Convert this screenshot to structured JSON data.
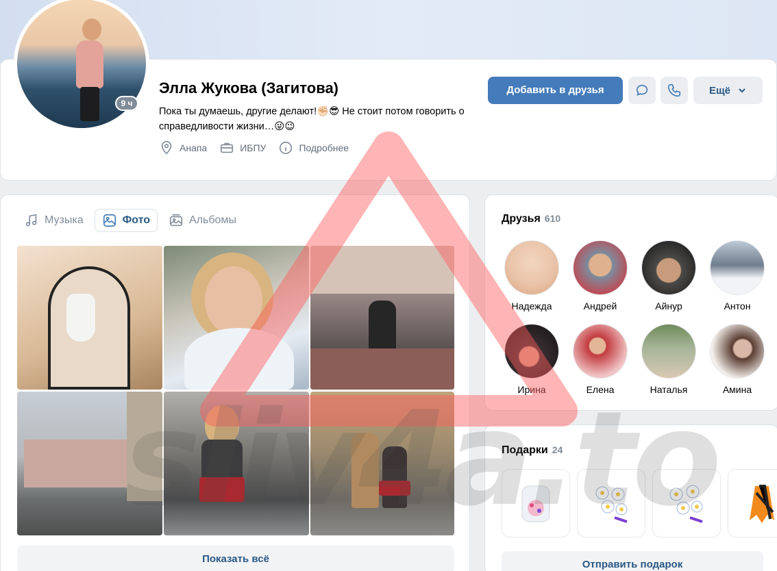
{
  "profile": {
    "name": "Элла Жукова (Загитова)",
    "status": "Пока ты думаешь, другие делают!✊🏻😎 Не стоит потом говорить о справедливости жизни…😜😉",
    "time_ago": "9 ч",
    "meta": {
      "city": "Анапа",
      "work": "ИБПУ",
      "details": "Подробнее"
    }
  },
  "actions": {
    "add_friend": "Добавить в друзья",
    "more": "Ещё"
  },
  "tabs": [
    {
      "label": "Музыка",
      "icon": "music-note-icon"
    },
    {
      "label": "Фото",
      "icon": "photo-icon"
    },
    {
      "label": "Альбомы",
      "icon": "albums-icon"
    }
  ],
  "photos": {
    "show_all": "Показать всё"
  },
  "friends": {
    "title": "Друзья",
    "count": "610",
    "list": [
      {
        "name": "Надежда",
        "color": "#e9c3a8"
      },
      {
        "name": "Андрей",
        "color": "#7b8d9e"
      },
      {
        "name": "Айнур",
        "color": "#8a7a6a"
      },
      {
        "name": "Антон",
        "color": "#c9d3de"
      },
      {
        "name": "Ирина",
        "color": "#3b3033"
      },
      {
        "name": "Елена",
        "color": "#d7464a"
      },
      {
        "name": "Наталья",
        "color": "#6f8b5a"
      },
      {
        "name": "Амина",
        "color": "#d9b8a7"
      }
    ]
  },
  "gifts": {
    "title": "Подарки",
    "count": "24",
    "send": "Отправить подарок"
  },
  "watermark": "sliv4a.to"
}
